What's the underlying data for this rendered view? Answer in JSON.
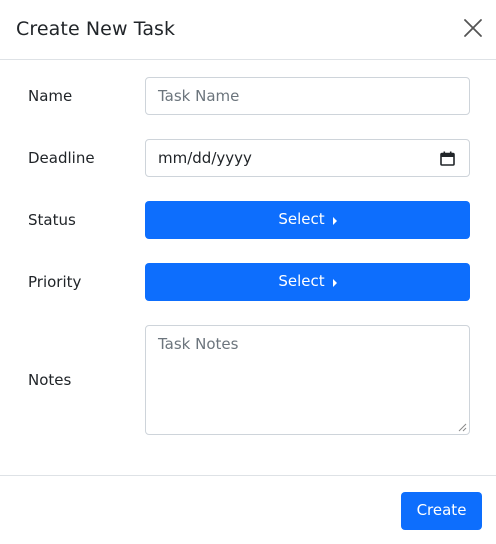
{
  "modal": {
    "title": "Create New Task",
    "close_icon": "close-icon"
  },
  "form": {
    "name": {
      "label": "Name",
      "placeholder": "Task Name",
      "value": ""
    },
    "deadline": {
      "label": "Deadline",
      "value": "mm/dd/yyyy",
      "icon": "calendar-icon"
    },
    "status": {
      "label": "Status",
      "button_label": "Select",
      "icon": "caret-right-icon"
    },
    "priority": {
      "label": "Priority",
      "button_label": "Select",
      "icon": "caret-right-icon"
    },
    "notes": {
      "label": "Notes",
      "placeholder": "Task Notes",
      "value": ""
    }
  },
  "footer": {
    "create_label": "Create"
  },
  "colors": {
    "primary": "#0d6efd",
    "border": "#ced4da",
    "divider": "#dee2e6",
    "text": "#212529",
    "placeholder": "#6c757d"
  }
}
